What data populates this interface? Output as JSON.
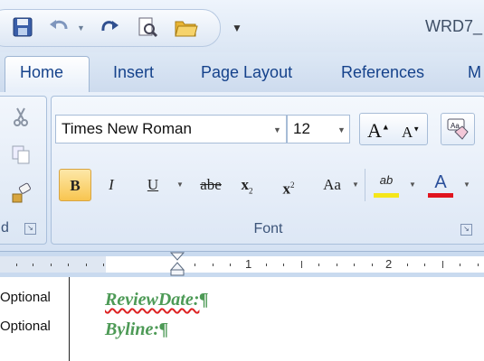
{
  "window": {
    "title": "WRD7_"
  },
  "colors": {
    "accent": "#15428b",
    "doc_text": "#4d9a56",
    "highlight": "#f5e61a",
    "font_color": "#e0141e"
  },
  "qat": {
    "icons": [
      "save-icon",
      "undo-icon",
      "redo-icon",
      "print-preview-icon",
      "open-folder-icon",
      "customize-qat-icon"
    ]
  },
  "tabs": [
    {
      "label": "Home",
      "selected": true
    },
    {
      "label": "Insert"
    },
    {
      "label": "Page Layout"
    },
    {
      "label": "References"
    },
    {
      "label": "M"
    }
  ],
  "clipboard": {
    "label": "d"
  },
  "font_group": {
    "font_name": "Times New Roman",
    "font_size": "12",
    "label": "Font",
    "buttons": {
      "bold": "B",
      "italic": "I",
      "underline": "U",
      "strikethrough": "abe",
      "subscript": "x",
      "subscript_suffix": "2",
      "superscript": "x",
      "superscript_suffix": "2",
      "change_case": "Aa",
      "highlight": "ab",
      "font_color": "A",
      "grow": "A",
      "shrink": "A"
    }
  },
  "ruler": {
    "numbers": [
      "1",
      "2"
    ]
  },
  "document": {
    "style_labels": [
      "Optional",
      "Optional"
    ],
    "lines": [
      {
        "text": "ReviewDate:",
        "mark": "¶"
      },
      {
        "text": "Byline:",
        "mark": "¶"
      }
    ]
  }
}
